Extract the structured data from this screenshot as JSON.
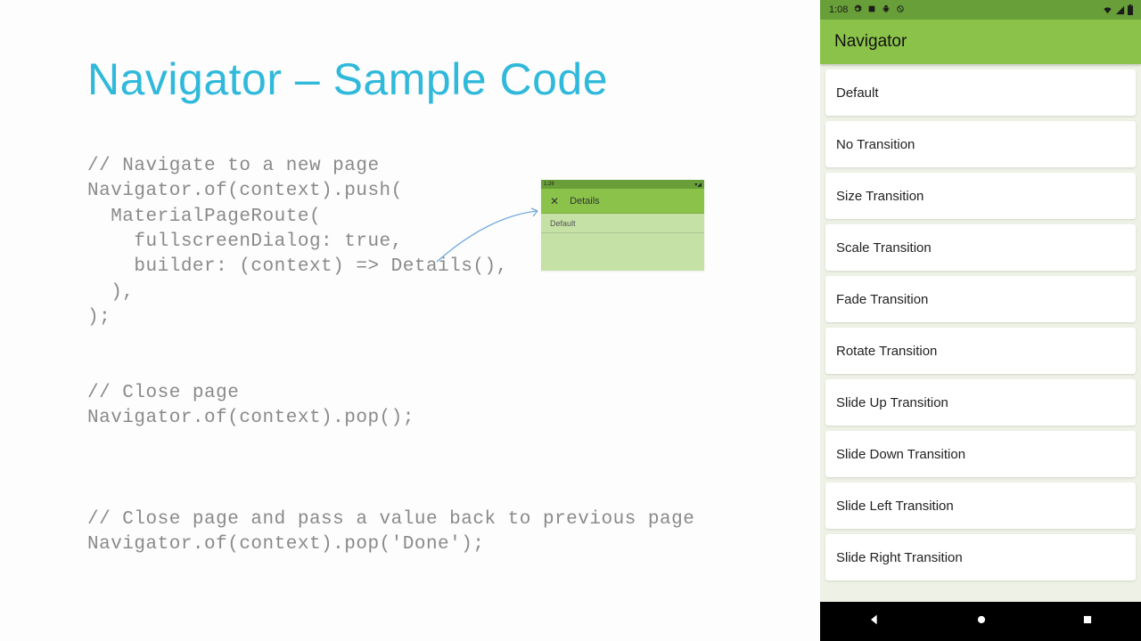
{
  "slide": {
    "title": "Navigator – Sample Code",
    "code": "// Navigate to a new page\nNavigator.of(context).push(\n  MaterialPageRoute(\n    fullscreenDialog: true,\n    builder: (context) => Details(),\n  ),\n);\n\n\n// Close page\nNavigator.of(context).pop();\n\n\n\n// Close page and pass a value back to previous page\nNavigator.of(context).pop('Done');"
  },
  "inset": {
    "status_time": "1:26",
    "appbar_title": "Details",
    "row_label": "Default"
  },
  "phone": {
    "status_time": "1:08",
    "appbar_title": "Navigator",
    "items": [
      "Default",
      "No Transition",
      "Size Transition",
      "Scale Transition",
      "Fade Transition",
      "Rotate Transition",
      "Slide Up Transition",
      "Slide Down Transition",
      "Slide Left Transition",
      "Slide Right Transition"
    ]
  }
}
